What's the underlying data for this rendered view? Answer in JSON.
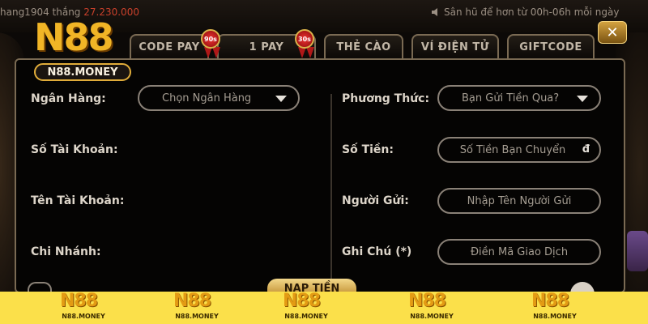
{
  "ticker": {
    "left_user": "hang1904 thắng",
    "left_amount": "27.230.000",
    "right_text": "Sân hũ để hơn từ 00h-06h mỗi ngày"
  },
  "brand": {
    "logo_text": "N88",
    "logo_sub": "N88.MONEY"
  },
  "tabs": [
    {
      "label": "CODE PAY",
      "badge": "90s"
    },
    {
      "label": "1 PAY",
      "badge": "30s"
    },
    {
      "label": "THẺ CÀO"
    },
    {
      "label": "VÍ ĐIỆN TỬ"
    },
    {
      "label": "GIFTCODE"
    }
  ],
  "form": {
    "left": {
      "bank_label": "Ngân Hàng:",
      "bank_select": "Chọn Ngân Hàng",
      "account_number_label": "Số Tài Khoản:",
      "account_name_label": "Tên Tài Khoản:",
      "branch_label": "Chi Nhánh:"
    },
    "right": {
      "method_label": "Phương Thức:",
      "method_select": "Bạn Gửi Tiền Qua?",
      "amount_label": "Số Tiền:",
      "amount_placeholder": "Số Tiền Bạn Chuyển",
      "currency": "đ",
      "sender_label": "Người Gửi:",
      "sender_placeholder": "Nhập Tên Người Gửi",
      "note_label": "Ghi Chú (*)",
      "note_placeholder": "Điền Mã Giao Dịch"
    },
    "submit_label": "NẠP TIỀN"
  },
  "footer": {
    "logo_big": "N88",
    "logo_small": "N88.MONEY"
  },
  "colors": {
    "accent_gold": "#e0ac3a",
    "footer_yellow": "#fbe04a",
    "badge_red": "#cc2222"
  },
  "icons": [
    "speaker-icon",
    "close-icon",
    "chevron-down-icon"
  ]
}
